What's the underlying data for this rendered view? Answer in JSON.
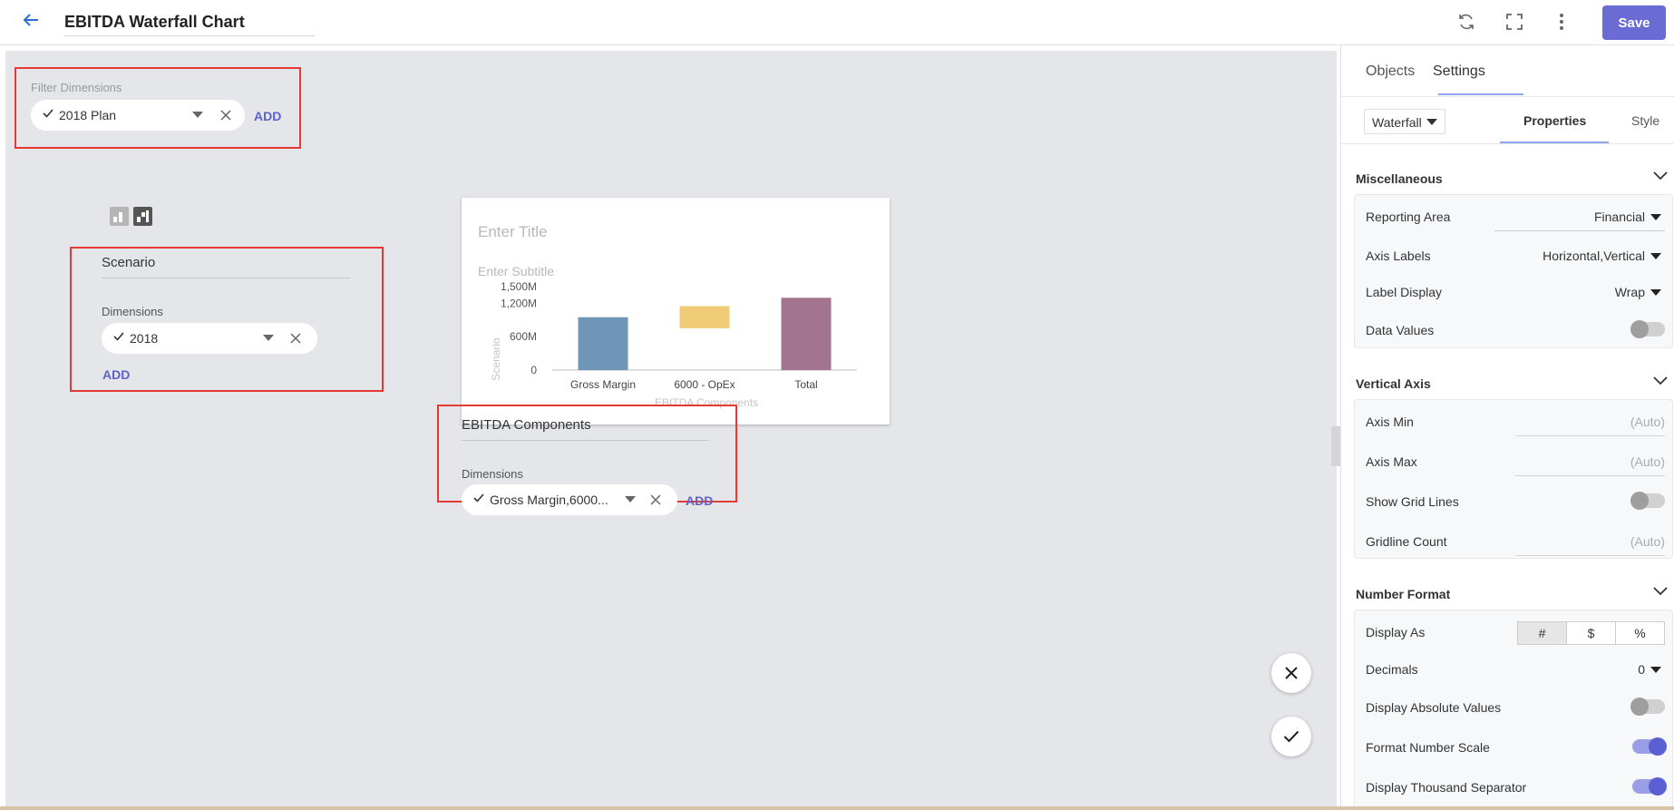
{
  "header": {
    "title": "EBITDA Waterfall Chart",
    "save_label": "Save",
    "icons": [
      "back-arrow-icon",
      "refresh-icon",
      "fullscreen-icon",
      "more-vertical-icon"
    ]
  },
  "canvas": {
    "filter": {
      "label": "Filter Dimensions",
      "chip": "2018 Plan",
      "add_label": "ADD"
    },
    "scenario": {
      "title": "Scenario",
      "dimensions_label": "Dimensions",
      "chip": "2018",
      "add_label": "ADD"
    },
    "components": {
      "title": "EBITDA Components",
      "dimensions_label": "Dimensions",
      "chip": "Gross Margin,6000...",
      "add_label": "ADD"
    },
    "chart_card": {
      "title_placeholder": "Enter Title",
      "subtitle_placeholder": "Enter Subtitle"
    }
  },
  "chart_data": {
    "type": "bar",
    "subtype": "waterfall",
    "title": "",
    "xlabel": "EBITDA Components",
    "ylabel": "Scenario",
    "categories": [
      "Gross Margin",
      "6000 - OpEx",
      "Total"
    ],
    "series": [
      {
        "values": [
          950,
          -400,
          1300
        ],
        "base": [
          0,
          1150,
          0
        ],
        "colors": [
          "#6f95b8",
          "#f0cc78",
          "#a3748f"
        ]
      }
    ],
    "yticks": [
      "0",
      "600M",
      "1,200M",
      "1,500M"
    ],
    "ytick_values": [
      0,
      600,
      1200,
      1500
    ],
    "ylim": [
      0,
      1500
    ],
    "grid": false
  },
  "panel": {
    "tabs": [
      "Objects",
      "Settings"
    ],
    "active_tab": "Settings",
    "chart_type": "Waterfall",
    "subtabs": [
      "Properties",
      "Style"
    ],
    "active_subtab": "Properties",
    "miscellaneous": {
      "title": "Miscellaneous",
      "reporting_area_label": "Reporting Area",
      "reporting_area_value": "Financial",
      "axis_labels_label": "Axis Labels",
      "axis_labels_value": "Horizontal,Vertical",
      "label_display_label": "Label Display",
      "label_display_value": "Wrap",
      "data_values_label": "Data Values",
      "data_values_on": false
    },
    "vertical_axis": {
      "title": "Vertical Axis",
      "axis_min_label": "Axis Min",
      "axis_min_placeholder": "(Auto)",
      "axis_max_label": "Axis Max",
      "axis_max_placeholder": "(Auto)",
      "show_grid_lines_label": "Show Grid Lines",
      "show_grid_lines_on": false,
      "gridline_count_label": "Gridline Count",
      "gridline_count_placeholder": "(Auto)"
    },
    "number_format": {
      "title": "Number Format",
      "display_as_label": "Display As",
      "display_as_options": [
        "#",
        "$",
        "%"
      ],
      "display_as_selected": "#",
      "decimals_label": "Decimals",
      "decimals_value": "0",
      "display_absolute_label": "Display Absolute Values",
      "display_absolute_on": false,
      "format_scale_label": "Format Number Scale",
      "format_scale_on": true,
      "thousand_sep_label": "Display Thousand Separator",
      "thousand_sep_on": true
    }
  },
  "colors": {
    "accent": "#6a6bd3",
    "highlight_border": "#e53935",
    "canvas_bg": "#e5e6ea"
  }
}
